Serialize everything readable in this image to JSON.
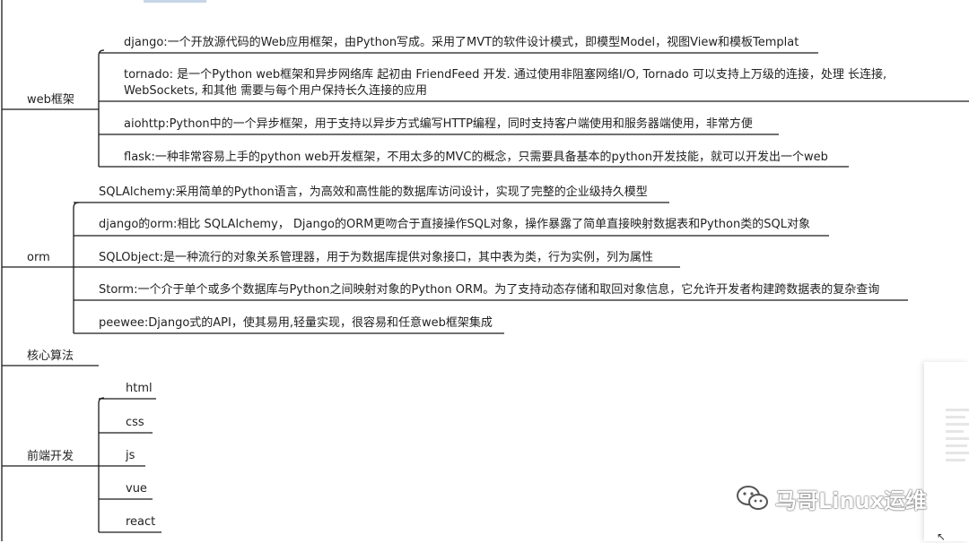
{
  "mindmap": {
    "categories": [
      {
        "label": "web框架",
        "children": [
          "django:一个开放源代码的Web应用框架，由Python写成。采用了MVT的软件设计模式，即模型Model，视图View和模板Templat",
          "tornado: 是一个Python web框架和异步网络库 起初由 FriendFeed 开发. 通过使用非阻塞网络I/O, Tornado 可以支持上万级的连接，处理 长连接, WebSockets, 和其他 需要与每个用户保持长久连接的应用",
          "aiohttp:Python中的一个异步框架，用于支持以异步方式编写HTTP编程，同时支持客户端使用和服务器端使用，非常方便",
          "flask:一种非常容易上手的python web开发框架，不用太多的MVC的概念，只需要具备基本的python开发技能，就可以开发出一个web"
        ]
      },
      {
        "label": "orm",
        "children": [
          "SQLAlchemy:采用简单的Python语言，为高效和高性能的数据库访问设计，实现了完整的企业级持久模型",
          "django的orm:相比 SQLAlchemy， Django的ORM更吻合于直接操作SQL对象，操作暴露了简单直接映射数据表和Python类的SQL对象",
          "SQLObject:是一种流行的对象关系管理器，用于为数据库提供对象接口，其中表为类，行为实例，列为属性",
          "Storm:一个介于单个或多个数据库与Python之间映射对象的Python ORM。为了支持动态存储和取回对象信息，它允许开发者构建跨数据表的复杂查询",
          "peewee:Django式的API，使其易用,轻量实现，很容易和任意web框架集成"
        ]
      },
      {
        "label": "核心算法",
        "children": []
      },
      {
        "label": "前端开发",
        "children": [
          "html",
          "css",
          "js",
          "vue",
          "react"
        ]
      }
    ]
  },
  "watermark": {
    "text": "马哥Linux运维",
    "icon": "wechat-icon"
  },
  "colors": {
    "line": "#1a1a1a",
    "text": "#222222"
  }
}
